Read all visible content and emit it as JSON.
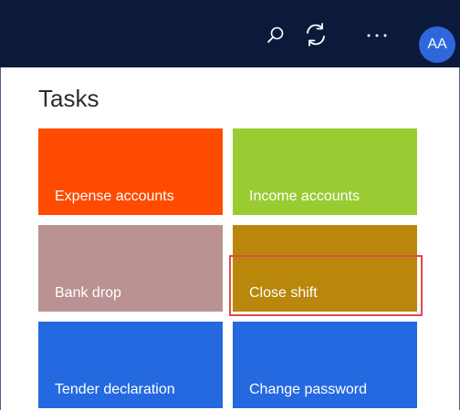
{
  "header": {
    "actions": [
      {
        "icon": "search-icon"
      },
      {
        "icon": "refresh-icon"
      },
      {
        "icon": "more-icon"
      }
    ],
    "avatar": {
      "initials": "AA",
      "color": "#2e66dc"
    },
    "background": "#0b1a3b"
  },
  "page": {
    "title": "Tasks"
  },
  "tiles": [
    {
      "label": "Expense accounts",
      "color": "#fe4b00"
    },
    {
      "label": "Income accounts",
      "color": "#99cc33"
    },
    {
      "label": "Bank drop",
      "color": "#ba9292"
    },
    {
      "label": "Close shift",
      "color": "#b8870c",
      "highlighted": true
    },
    {
      "label": "Tender declaration",
      "color": "#2569e1"
    },
    {
      "label": "Change password",
      "color": "#2569e1"
    }
  ],
  "colors": {
    "highlight": "#e2494a"
  }
}
